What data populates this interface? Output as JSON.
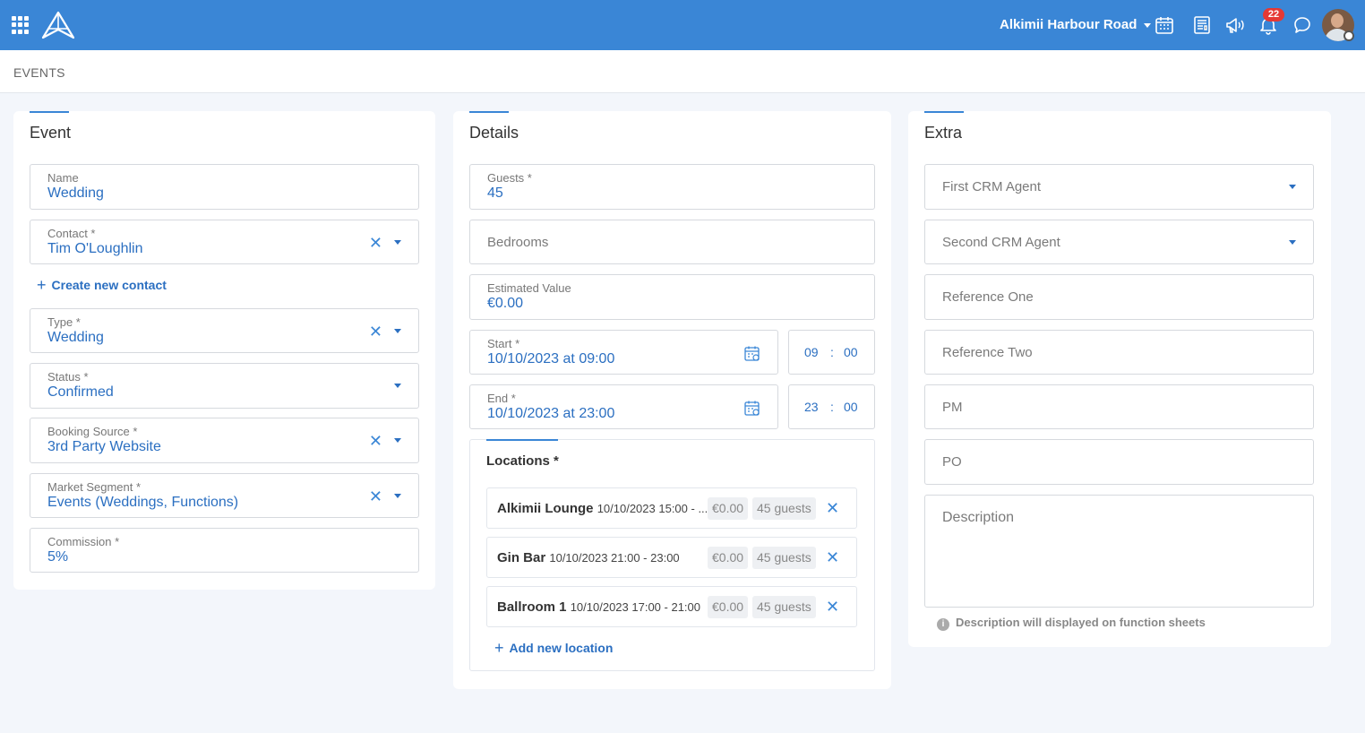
{
  "header": {
    "venue": "Alkimii Harbour Road",
    "notification_count": "22"
  },
  "breadcrumb": "EVENTS",
  "event": {
    "title": "Event",
    "name_label": "Name",
    "name_value": "Wedding",
    "contact_label": "Contact *",
    "contact_value": "Tim O'Loughlin",
    "create_contact": "Create new contact",
    "type_label": "Type *",
    "type_value": "Wedding",
    "status_label": "Status *",
    "status_value": "Confirmed",
    "booking_label": "Booking Source *",
    "booking_value": "3rd Party Website",
    "segment_label": "Market Segment *",
    "segment_value": "Events (Weddings, Functions)",
    "commission_label": "Commission *",
    "commission_value": "5%"
  },
  "details": {
    "title": "Details",
    "guests_label": "Guests *",
    "guests_value": "45",
    "bedrooms_placeholder": "Bedrooms",
    "estimated_label": "Estimated Value",
    "estimated_value": "€0.00",
    "start_label": "Start *",
    "start_value": "10/10/2023 at 09:00",
    "start_hour": "09",
    "start_minute": "00",
    "end_label": "End *",
    "end_value": "10/10/2023 at 23:00",
    "end_hour": "23",
    "end_minute": "00",
    "time_sep": ":",
    "locations_title": "Locations *",
    "locations": [
      {
        "name": "Alkimii Lounge",
        "time": "10/10/2023 15:00 - ...",
        "price": "€0.00",
        "guests": "45 guests"
      },
      {
        "name": "Gin Bar",
        "time": "10/10/2023 21:00 - 23:00",
        "price": "€0.00",
        "guests": "45 guests"
      },
      {
        "name": "Ballroom 1",
        "time": "10/10/2023 17:00 - 21:00",
        "price": "€0.00",
        "guests": "45 guests"
      }
    ],
    "add_location": "Add new location"
  },
  "extra": {
    "title": "Extra",
    "first_agent": "First CRM Agent",
    "second_agent": "Second CRM Agent",
    "ref_one": "Reference One",
    "ref_two": "Reference Two",
    "pm": "PM",
    "po": "PO",
    "description": "Description",
    "description_hint": "Description will displayed on function sheets"
  },
  "colors": {
    "brand": "#3a86d6",
    "value_text": "#2b6fc1",
    "badge": "#e53935"
  },
  "icons": {
    "clear": "✕",
    "plus": "+",
    "info": "i"
  }
}
